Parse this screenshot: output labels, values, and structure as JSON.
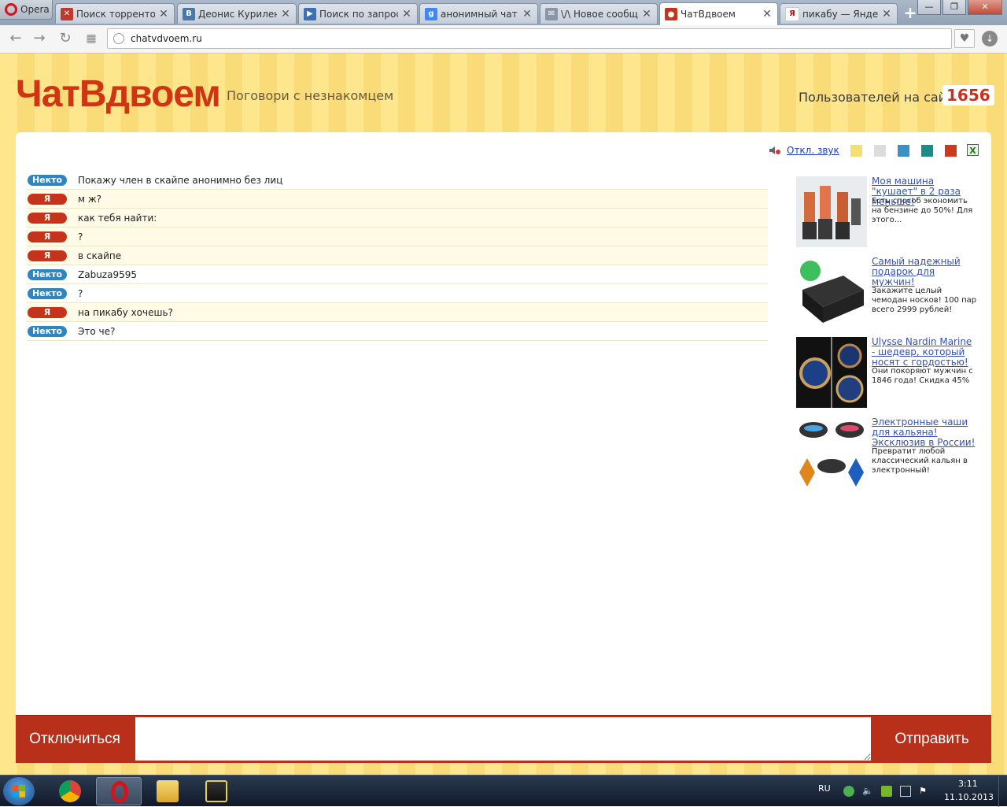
{
  "browser": {
    "menu_label": "Opera",
    "tabs": [
      {
        "title": "Поиск торрентов",
        "favicon": "torrent-icon",
        "color": "#c0392b",
        "glyph": "✕"
      },
      {
        "title": "Деонис Куриленко",
        "favicon": "vk-icon",
        "color": "#4a76a8",
        "glyph": "В"
      },
      {
        "title": "Поиск по запросу",
        "favicon": "play-icon",
        "color": "#3b6fb6",
        "glyph": "▶"
      },
      {
        "title": "анонимный чат - Google",
        "favicon": "google-icon",
        "color": "#4285f4",
        "glyph": "g"
      },
      {
        "title": "\\/\\ Новое сообщение",
        "favicon": "mail-icon",
        "color": "#8a96a6",
        "glyph": "✉"
      },
      {
        "title": "ЧатВдвоем",
        "favicon": "chat-bubble-icon",
        "color": "#c5331b",
        "glyph": "●",
        "active": true
      },
      {
        "title": "пикабу — Яндекс",
        "favicon": "yandex-icon",
        "color": "#ffffff",
        "glyph": "Я"
      }
    ],
    "new_tab_label": "+",
    "url": "chatvdvoem.ru"
  },
  "site": {
    "logo": "ЧатВдвоем",
    "slogan": "Поговори с незнакомцем",
    "users_label": "Пользователей на сайте",
    "users_count": "1656",
    "sound_toggle": "Откл. звук",
    "theme_colors": [
      "#f5de74",
      "#dcdcdc",
      "#3d8fc6",
      "#1e8a8a",
      "#cc3a1c"
    ]
  },
  "chat": {
    "stranger_label": "Некто",
    "me_label": "Я",
    "messages": [
      {
        "from": "stranger",
        "text": "Покажу член в скайпе анонимно без лиц"
      },
      {
        "from": "me",
        "text": "м ж?"
      },
      {
        "from": "me",
        "text": "как тебя найти:"
      },
      {
        "from": "me",
        "text": "?"
      },
      {
        "from": "me",
        "text": "в скайпе"
      },
      {
        "from": "stranger",
        "text": "Zabuza9595"
      },
      {
        "from": "stranger",
        "text": "?"
      },
      {
        "from": "me",
        "text": "на пикабу хочешь?"
      },
      {
        "from": "stranger",
        "text": "Это че?"
      }
    ]
  },
  "ads": [
    {
      "title": "Моя машина \"кушает\" в 2 раза меньше!",
      "desc": "Есть способ экономить на бензине до 50%! Для этого...",
      "image": "fuel-injectors"
    },
    {
      "title": "Самый надежный подарок для мужчин!",
      "desc": "Закажите целый чемодан носков! 100 пар всего 2999 рублей!",
      "image": "socks-case"
    },
    {
      "title": "Ulysse Nardin Marine - шедевр, который носят с гордостью!",
      "desc": "Они покоряют мужчин с 1846 года! Скидка 45%",
      "image": "watches"
    },
    {
      "title": "Электронные чаши для кальяна! Эксклюзив в России!",
      "desc": "Превратит любой классический кальян в электронный!",
      "image": "hookah-bowls"
    }
  ],
  "bottom": {
    "disconnect": "Отключиться",
    "send": "Отправить",
    "input_value": ""
  },
  "taskbar": {
    "lang": "RU",
    "time": "3:11",
    "date": "11.10.2013"
  }
}
